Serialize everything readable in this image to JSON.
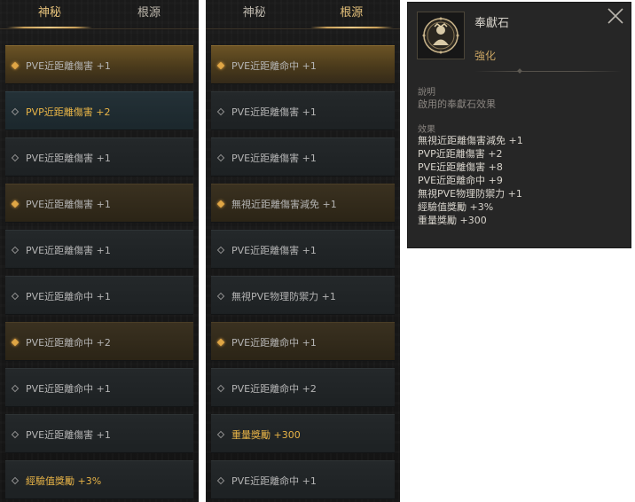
{
  "left_panel": {
    "tabs": [
      {
        "label": "神秘",
        "active": true
      },
      {
        "label": "根源",
        "active": false
      }
    ],
    "items": [
      {
        "label": "PVE近距離傷害 +1",
        "style": "gold-sel",
        "marker": "gold",
        "highlight": false
      },
      {
        "label": "PVP近距離傷害 +2",
        "style": "blue",
        "marker": "plain",
        "highlight": true
      },
      {
        "label": "PVE近距離傷害 +1",
        "style": "plain",
        "marker": "plain",
        "highlight": false
      },
      {
        "label": "PVE近距離傷害 +1",
        "style": "brown",
        "marker": "gold",
        "highlight": false
      },
      {
        "label": "PVE近距離傷害 +1",
        "style": "plain",
        "marker": "plain",
        "highlight": false
      },
      {
        "label": "PVE近距離命中 +1",
        "style": "plain",
        "marker": "plain",
        "highlight": false
      },
      {
        "label": "PVE近距離命中 +2",
        "style": "brown",
        "marker": "gold",
        "highlight": false
      },
      {
        "label": "PVE近距離命中 +1",
        "style": "plain",
        "marker": "plain",
        "highlight": false
      },
      {
        "label": "PVE近距離傷害 +1",
        "style": "plain",
        "marker": "plain",
        "highlight": false
      },
      {
        "label": "經驗值獎勵 +3%",
        "style": "plain",
        "marker": "plain",
        "highlight": true
      }
    ]
  },
  "mid_panel": {
    "tabs": [
      {
        "label": "神秘",
        "active": false
      },
      {
        "label": "根源",
        "active": true
      }
    ],
    "items": [
      {
        "label": "PVE近距離命中 +1",
        "style": "gold-sel",
        "marker": "gold",
        "highlight": false
      },
      {
        "label": "PVE近距離傷害 +1",
        "style": "plain",
        "marker": "plain",
        "highlight": false
      },
      {
        "label": "PVE近距離傷害 +1",
        "style": "plain",
        "marker": "plain",
        "highlight": false
      },
      {
        "label": "無視近距離傷害減免 +1",
        "style": "brown",
        "marker": "gold",
        "highlight": false
      },
      {
        "label": "PVE近距離傷害 +1",
        "style": "plain",
        "marker": "plain",
        "highlight": false
      },
      {
        "label": "無視PVE物理防禦力 +1",
        "style": "plain",
        "marker": "plain",
        "highlight": false
      },
      {
        "label": "PVE近距離命中 +1",
        "style": "brown",
        "marker": "gold",
        "highlight": false
      },
      {
        "label": "PVE近距離命中 +2",
        "style": "plain",
        "marker": "plain",
        "highlight": false
      },
      {
        "label": "重量獎勵 +300",
        "style": "plain",
        "marker": "plain",
        "highlight": true
      },
      {
        "label": "PVE近距離命中 +1",
        "style": "plain",
        "marker": "plain",
        "highlight": false
      }
    ]
  },
  "info_panel": {
    "title": "奉獻石",
    "subtitle": "強化",
    "description_label": "說明",
    "description": "啟用的奉獻石效果",
    "effects_label": "效果",
    "effects": [
      "無視近距離傷害減免 +1",
      "PVP近距離傷害 +2",
      "PVE近距離傷害 +8",
      "PVE近距離命中 +9",
      "無視PVE物理防禦力 +1",
      "經驗值獎勵 +3%",
      "重量獎勵 +300"
    ],
    "icon": "devotion-stone-icon",
    "close_icon": "close-icon"
  },
  "colors": {
    "accent_gold": "#e8b447",
    "tab_active": "#e4c07a",
    "text_plain": "#b4b4b4"
  }
}
